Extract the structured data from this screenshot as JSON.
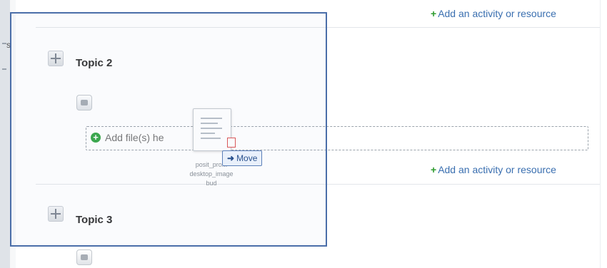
{
  "course": {
    "add_activity_label": "Add an activity or resource",
    "topics": [
      {
        "title": "Topic 2"
      },
      {
        "title": "Topic 3"
      }
    ]
  },
  "dropzone": {
    "text": "Add file(s) he"
  },
  "drag_file": {
    "caption_lines": [
      "posit_pro...",
      "desktop_image",
      "bud"
    ]
  },
  "tooltip": {
    "label": "Move"
  },
  "rail": {
    "fragment": "s"
  },
  "colors": {
    "link": "#3a6fb0",
    "plus": "#2d9b2d",
    "selection": "#4a6ea9",
    "add_circle": "#3aa84a"
  },
  "icons": {
    "move_handle": "move-icon",
    "add_circle": "add-circle-icon",
    "plus": "plus-icon",
    "arrow": "arrow-right-icon",
    "file": "file-icon"
  }
}
